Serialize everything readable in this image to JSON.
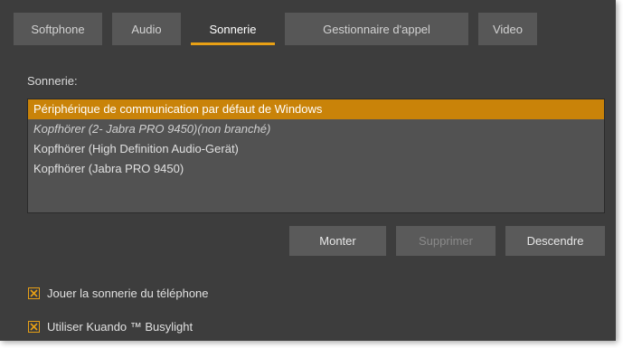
{
  "tabs": [
    {
      "label": "Softphone",
      "active": false
    },
    {
      "label": "Audio",
      "active": false
    },
    {
      "label": "Sonnerie",
      "active": true
    },
    {
      "label": "Gestionnaire d'appel",
      "active": false
    },
    {
      "label": "Video",
      "active": false
    }
  ],
  "ringtone": {
    "label": "Sonnerie:",
    "devices": [
      {
        "label": "Périphérique de communication par défaut de Windows",
        "selected": true,
        "unplugged": false
      },
      {
        "label": "Kopfhörer (2- Jabra PRO 9450)(non branché)",
        "selected": false,
        "unplugged": true
      },
      {
        "label": "Kopfhörer (High Definition Audio-Gerät)",
        "selected": false,
        "unplugged": false
      },
      {
        "label": "Kopfhörer (Jabra PRO 9450)",
        "selected": false,
        "unplugged": false
      }
    ]
  },
  "buttons": {
    "up": "Monter",
    "delete": "Supprimer",
    "down": "Descendre"
  },
  "options": {
    "play_ring": {
      "label": "Jouer la sonnerie du téléphone",
      "checked": true
    },
    "busylight": {
      "label": "Utiliser Kuando ™ Busylight",
      "checked": true
    }
  },
  "colors": {
    "accent": "#e8a015",
    "selection": "#c98309",
    "background": "#3d3d3d"
  }
}
